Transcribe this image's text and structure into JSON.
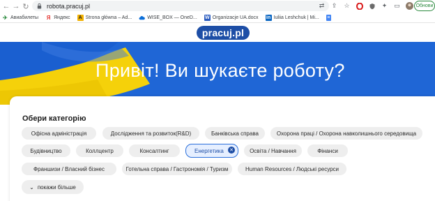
{
  "browser": {
    "url": "robota.pracuj.pl",
    "update_label": "Обнови",
    "bookmarks": [
      {
        "label": "Авиабилеты",
        "icon": "plane-icon",
        "color": "#2b8a3e"
      },
      {
        "label": "Яндекс",
        "icon": "yandex-icon",
        "color": "#e53935"
      },
      {
        "label": "Strona główna – Ad...",
        "icon": "a-icon",
        "color": "#f2b100"
      },
      {
        "label": "WISE_BOX — OneD...",
        "icon": "onedrive-icon",
        "color": "#0b6ed8"
      },
      {
        "label": "Organizacje UA.docx",
        "icon": "word-icon",
        "color": "#2b5cbf"
      },
      {
        "label": "Iuliia Leshchuk | Mi...",
        "icon": "linkedin-icon",
        "color": "#0a66c2"
      },
      {
        "label": "",
        "icon": "docs-icon",
        "color": "#4285f4"
      }
    ]
  },
  "site": {
    "logo": "pracuj.pl",
    "hero_title": "Привіт! Ви шукаєте роботу?"
  },
  "categories": {
    "title": "Обери категорію",
    "chips": [
      {
        "label": "Офісна адміністрація",
        "selected": false
      },
      {
        "label": "Дослідження та розвиток(R&D)",
        "selected": false
      },
      {
        "label": "Банківська справа",
        "selected": false
      },
      {
        "label": "Охорона праці / Охорона навколишнього середовища",
        "selected": false
      },
      {
        "label": "Будівництво",
        "selected": false
      },
      {
        "label": "Коллцентр",
        "selected": false
      },
      {
        "label": "Консалтинг",
        "selected": false
      },
      {
        "label": "Енергетика",
        "selected": true
      },
      {
        "label": "Освіта / Навчання",
        "selected": false
      },
      {
        "label": "Фінанси",
        "selected": false
      },
      {
        "label": "Франшизи / Власний бізнес",
        "selected": false
      },
      {
        "label": "Готельна справа / Гастрономія / Туризм",
        "selected": false
      },
      {
        "label": "Human Resources / Людські ресурси",
        "selected": false
      }
    ],
    "more_label": "покажи більше"
  },
  "colors": {
    "brand_blue": "#1d4ea6",
    "hero_blue": "#1f66d6",
    "flag_yellow": "#f5d10a",
    "flag_blue": "#1a5fd0"
  }
}
